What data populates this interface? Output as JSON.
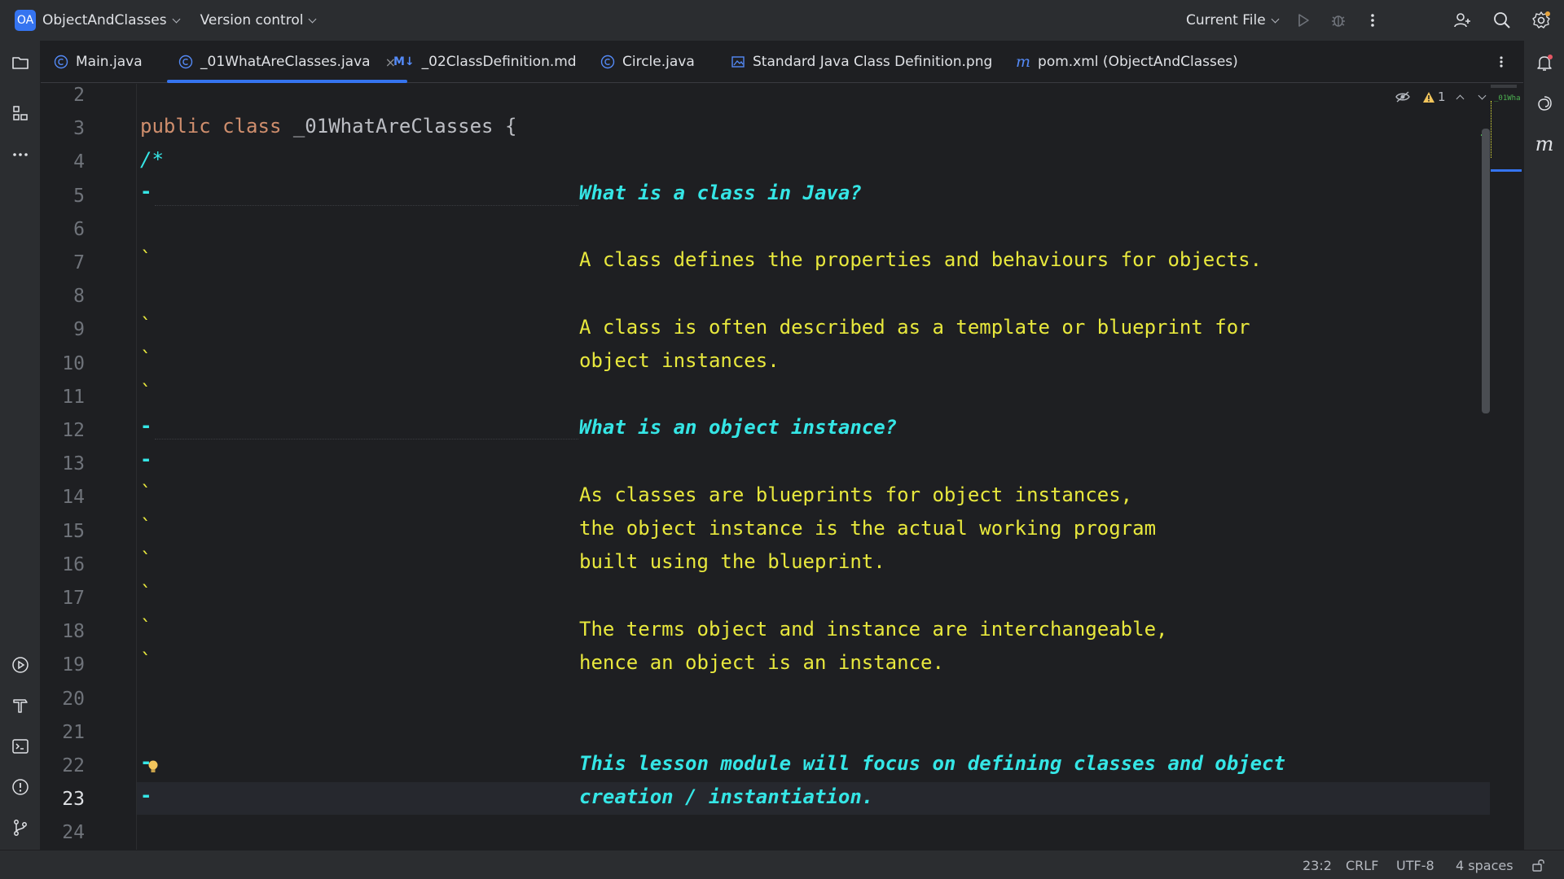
{
  "titlebar": {
    "project_badge": "OA",
    "project_name": "ObjectAndClasses",
    "vcs_label": "Version control",
    "run_config": "Current File",
    "icons": [
      "run-icon",
      "debug-icon",
      "more-vertical-icon",
      "add-user-icon",
      "search-icon",
      "settings-icon"
    ]
  },
  "tabs": [
    {
      "label": "Main.java",
      "icon": "java-class-icon",
      "active": false
    },
    {
      "label": "_01WhatAreClasses.java",
      "icon": "java-class-icon",
      "active": true,
      "close": "×"
    },
    {
      "label": "_02ClassDefinition.md",
      "icon": "markdown-icon",
      "icon_text": "M↓",
      "active": false
    },
    {
      "label": "Circle.java",
      "icon": "java-class-icon",
      "active": false
    },
    {
      "label": "Standard Java Class Definition.png",
      "icon": "image-icon",
      "active": false
    },
    {
      "label": "pom.xml (ObjectAndClasses)",
      "icon": "maven-icon",
      "icon_text": "m",
      "active": false
    }
  ],
  "editor": {
    "inspection_count": "1",
    "line_numbers": [
      "2",
      "3",
      "4",
      "5",
      "6",
      "7",
      "8",
      "9",
      "10",
      "11",
      "12",
      "13",
      "14",
      "15",
      "16",
      "17",
      "18",
      "19",
      "20",
      "21",
      "22",
      "23",
      "24"
    ],
    "current_line": "23",
    "lines": {
      "l3_kw1": "public",
      "l3_kw2": "class",
      "l3_name": "_01WhatAreClasses {",
      "l4": "/*",
      "l5": "What is a class in Java?",
      "l7": "A class defines the properties and behaviours for objects.",
      "l9": "A class is often described as a template or blueprint for",
      "l10": "object instances.",
      "l12": "What is an object instance?",
      "l14": "As classes are blueprints for object instances,",
      "l15": "the object instance is the actual working program",
      "l16": "built using the blueprint.",
      "l18": "The terms object and instance are interchangeable,",
      "l19": "hence an object is an instance.",
      "l22": "This lesson module will focus on defining classes and object",
      "l23": "creation / instantiation."
    },
    "markers": {
      "dash": "-",
      "tick": "`"
    },
    "minimap_label": "_01Wha"
  },
  "statusbar": {
    "position": "23:2",
    "line_ending": "CRLF",
    "encoding": "UTF-8",
    "indent": "4 spaces"
  },
  "colors": {
    "accent": "#3574f0",
    "comment_yellow": "#e8e83d",
    "comment_cyan": "#35e6e6",
    "keyword": "#cf8e6d"
  }
}
